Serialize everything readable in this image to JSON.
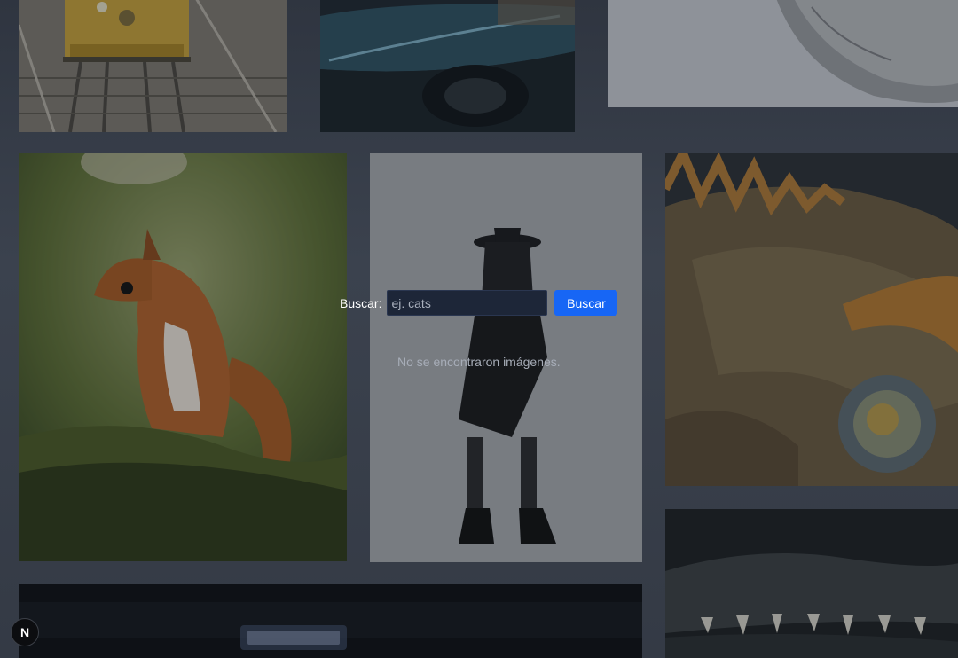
{
  "search": {
    "label": "Buscar:",
    "placeholder": "ej. cats",
    "value": "",
    "button_label": "Buscar"
  },
  "results": {
    "empty_message": "No se encontraron imágenes."
  },
  "badge": {
    "letter": "N"
  },
  "gallery": {
    "images": [
      {
        "subject": "tram"
      },
      {
        "subject": "car"
      },
      {
        "subject": "wolf"
      },
      {
        "subject": "squirrel"
      },
      {
        "subject": "model"
      },
      {
        "subject": "iguana"
      },
      {
        "subject": "neon-sign"
      },
      {
        "subject": "crocodile"
      }
    ]
  },
  "colors": {
    "accent": "#1766f5",
    "background": "#3a414d",
    "input_bg": "#1d2638"
  }
}
